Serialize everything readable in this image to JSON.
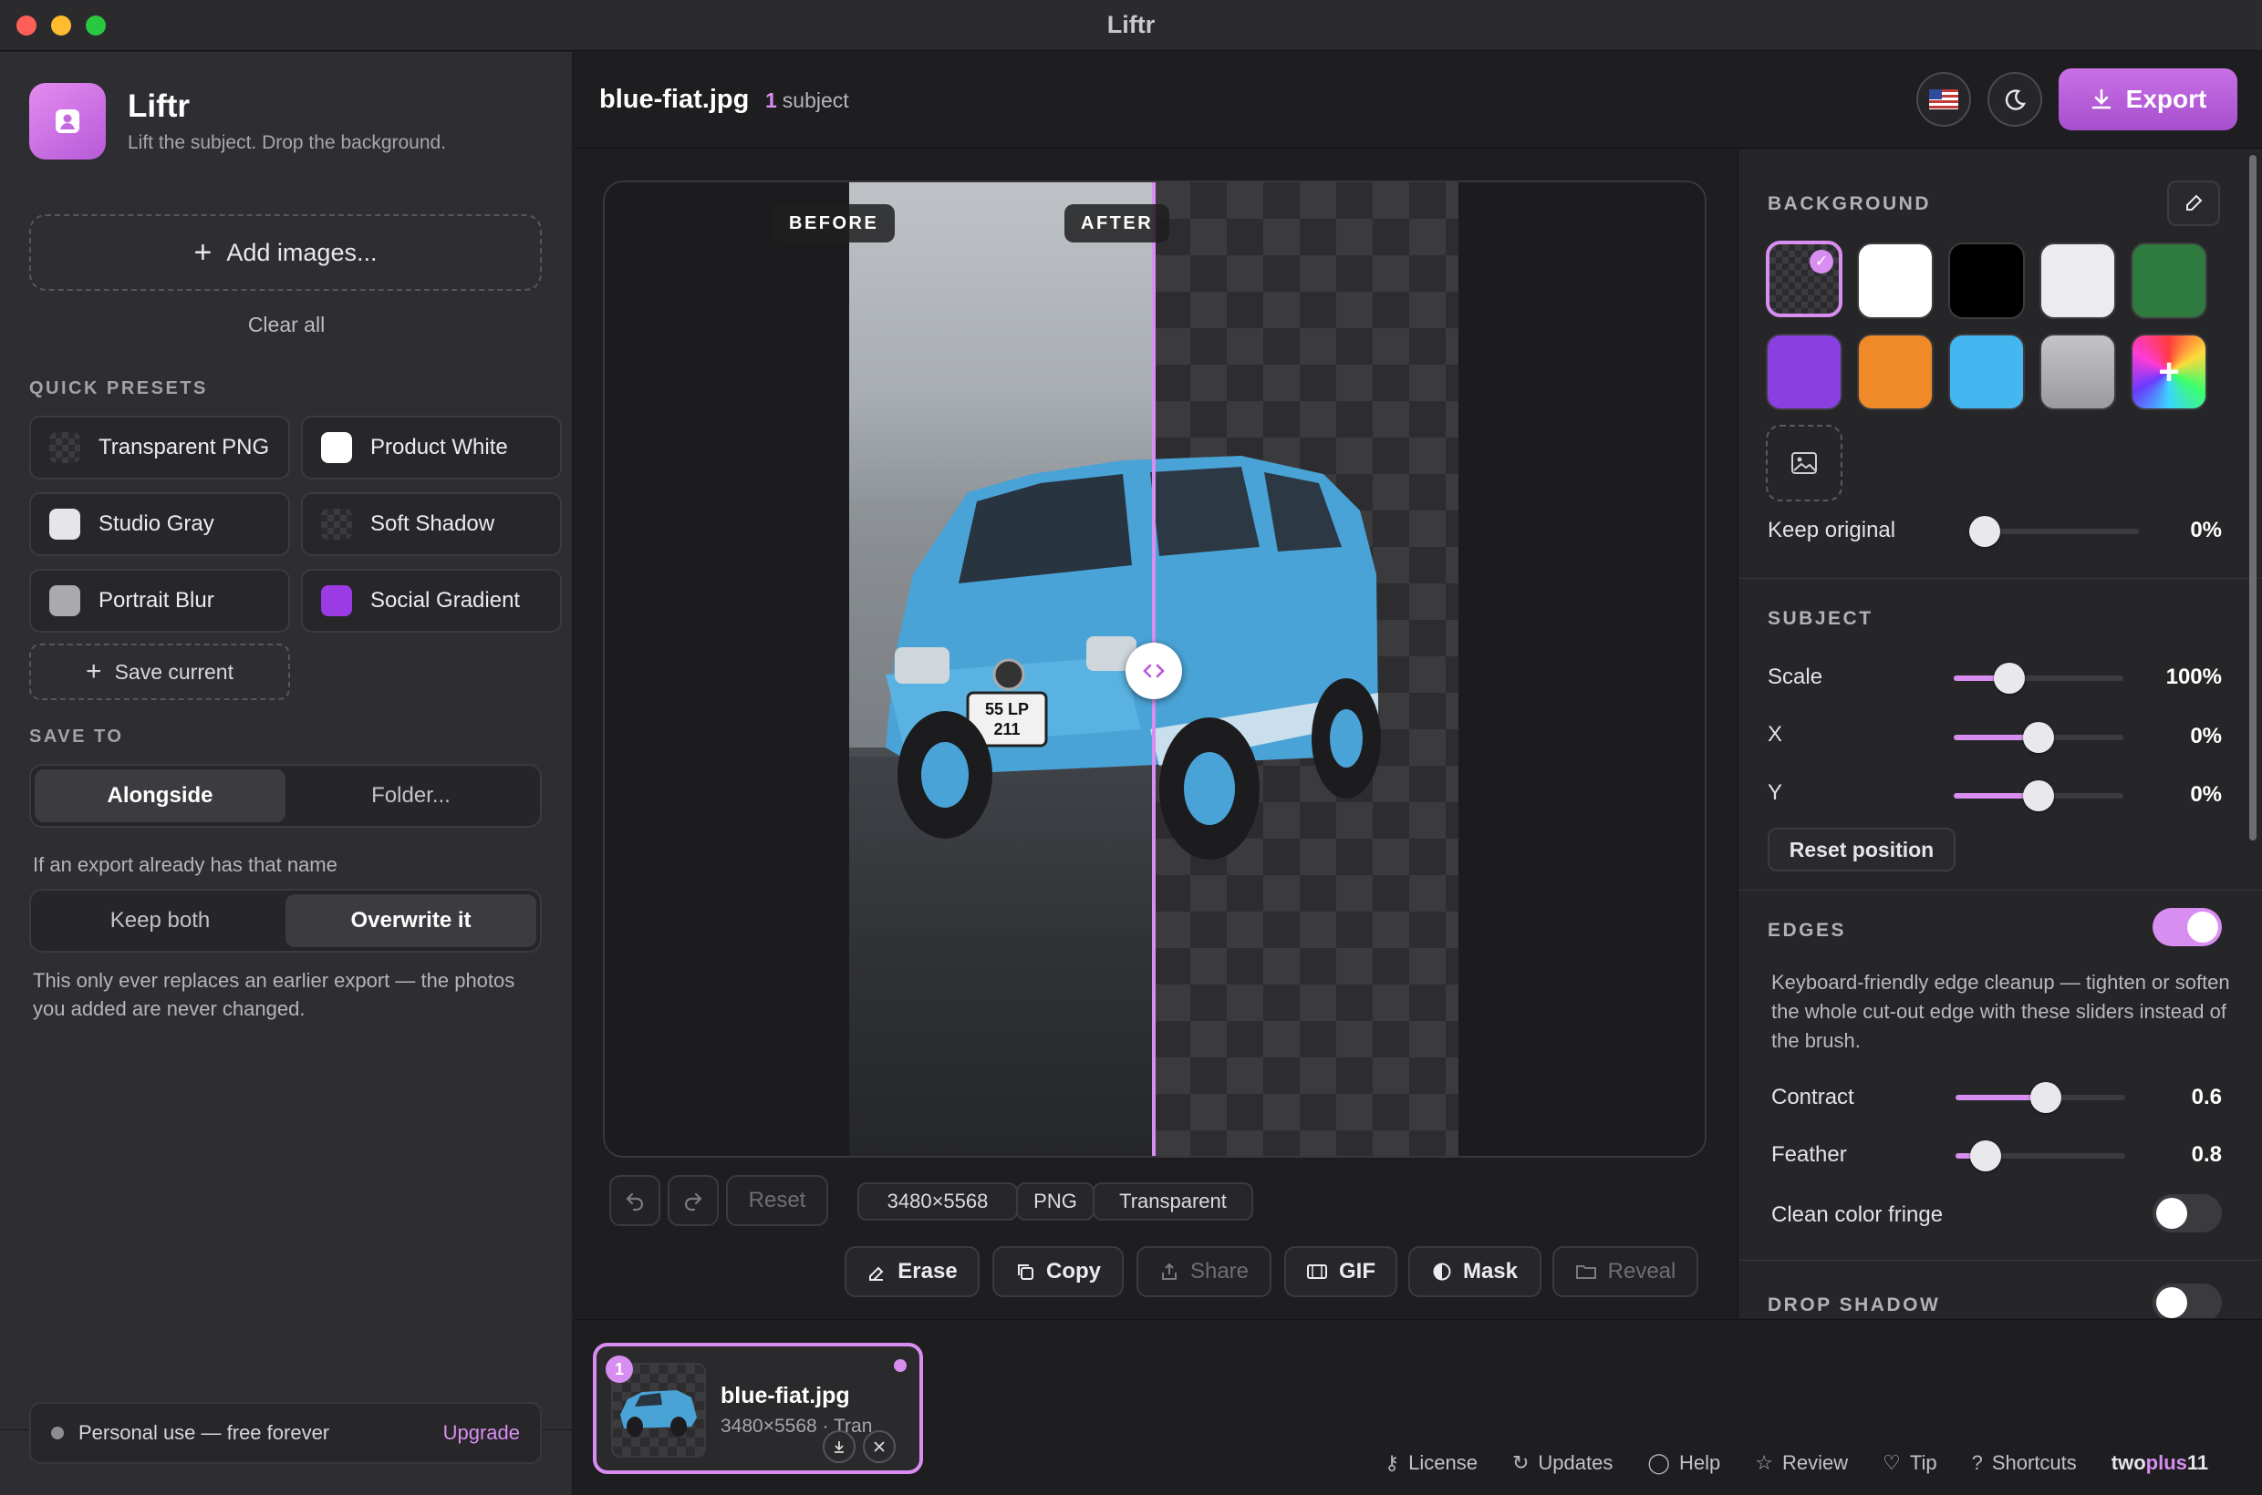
{
  "window": {
    "title": "Liftr"
  },
  "sidebar": {
    "brand_name": "Liftr",
    "brand_tagline": "Lift the subject. Drop the background.",
    "add_images_label": "Add images...",
    "clear_all_label": "Clear all",
    "quick_presets_title": "QUICK PRESETS",
    "presets": [
      {
        "label": "Transparent PNG",
        "swatch": "checker"
      },
      {
        "label": "Product White",
        "swatch": "#ffffff"
      },
      {
        "label": "Studio Gray",
        "swatch": "#e6e6e8"
      },
      {
        "label": "Soft Shadow",
        "swatch": "checker"
      },
      {
        "label": "Portrait Blur",
        "swatch": "#a9a9ae"
      },
      {
        "label": "Social Gradient",
        "swatch": "#9b3be6"
      }
    ],
    "save_current_label": "Save current",
    "save_to_title": "SAVE TO",
    "save_to_options": [
      "Alongside",
      "Folder..."
    ],
    "conflict_label": "If an export already has that name",
    "conflict_options": [
      "Keep both",
      "Overwrite it"
    ],
    "note": "This only ever replaces an earlier export — the photos you added are never changed.",
    "plan_label": "Personal use — free forever",
    "upgrade_label": "Upgrade"
  },
  "topbar": {
    "file_name": "blue-fiat.jpg",
    "subject_count": "1",
    "subject_label": "subject",
    "export_label": "Export"
  },
  "canvas": {
    "before_label": "BEFORE",
    "after_label": "AFTER",
    "plate_line1": "55  LP",
    "plate_line2": "211"
  },
  "toolbar": {
    "reset_label": "Reset",
    "dimensions": "3480×5568",
    "format": "PNG",
    "background_chip": "Transparent",
    "actions": [
      "Erase",
      "Copy",
      "Share",
      "GIF",
      "Mask",
      "Reveal"
    ]
  },
  "panel": {
    "background": {
      "title": "BACKGROUND",
      "swatches": [
        "checker",
        "#ffffff",
        "#000000",
        "#ececef",
        "#2f7a3e",
        "#8a3fe0",
        "#f08a28",
        "#45b7f0",
        "#b4b4b9",
        "rainbow"
      ],
      "keep_original_label": "Keep original",
      "keep_original_value": "0%",
      "keep_original_level": 0
    },
    "subject": {
      "title": "SUBJECT",
      "rows": [
        {
          "label": "Scale",
          "value": "100%",
          "level": 0.33
        },
        {
          "label": "X",
          "value": "0%",
          "level": 0.5
        },
        {
          "label": "Y",
          "value": "0%",
          "level": 0.5
        }
      ],
      "reset_position_label": "Reset position"
    },
    "edges": {
      "title": "EDGES",
      "enabled": true,
      "description": "Keyboard-friendly edge cleanup — tighten or soften the whole cut-out edge with these sliders instead of the brush.",
      "rows": [
        {
          "label": "Contract",
          "value": "0.6",
          "level": 0.53
        },
        {
          "label": "Feather",
          "value": "0.8",
          "level": 0.18
        }
      ],
      "fringe_label": "Clean color fringe",
      "fringe_enabled": false
    },
    "drop_shadow": {
      "title": "DROP SHADOW",
      "enabled": false
    }
  },
  "thumbnail": {
    "index": "1",
    "name": "blue-fiat.jpg",
    "meta": "3480×5568 · Tran"
  },
  "footer": {
    "links": [
      "License",
      "Updates",
      "Help",
      "Review",
      "Tip",
      "Shortcuts"
    ],
    "maker_a": "two",
    "maker_b": "plus",
    "maker_c": "11"
  },
  "colors": {
    "accent": "#d88ef0",
    "export": "#b65ad8"
  }
}
